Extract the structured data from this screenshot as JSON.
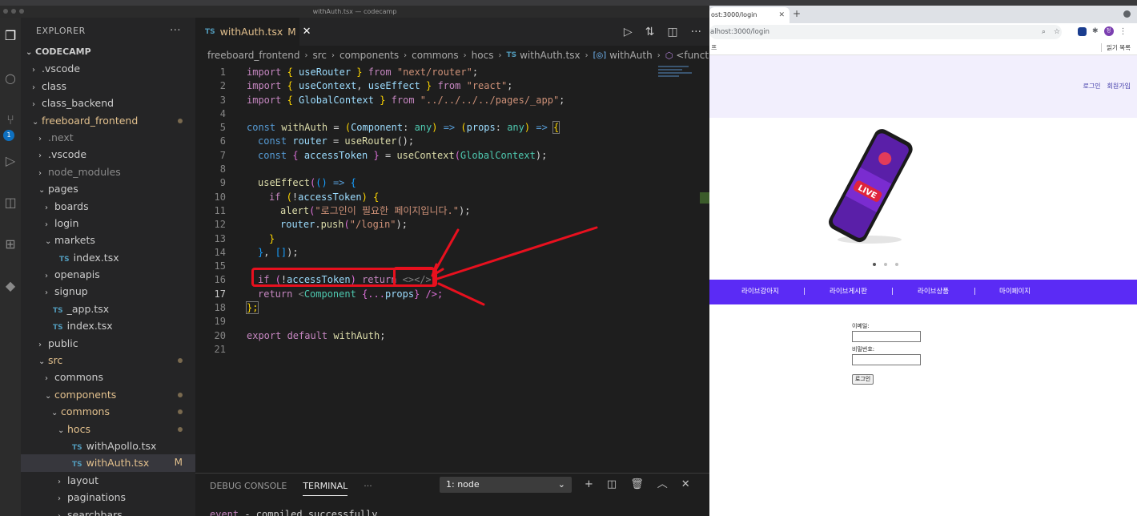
{
  "vscode": {
    "title": "withAuth.tsx — codecamp",
    "activity_badge": "1",
    "explorer": {
      "header": "EXPLORER",
      "more": "···",
      "project": "CODECAMP",
      "tree": [
        {
          "label": ".vscode",
          "depth": 1,
          "chev": "›",
          "kind": "folder"
        },
        {
          "label": "class",
          "depth": 1,
          "chev": "›",
          "kind": "folder"
        },
        {
          "label": "class_backend",
          "depth": 1,
          "chev": "›",
          "kind": "folder"
        },
        {
          "label": "freeboard_frontend",
          "depth": 1,
          "chev": "⌄",
          "kind": "folder",
          "modified": true
        },
        {
          "label": ".next",
          "depth": 2,
          "chev": "›",
          "kind": "folder",
          "dim": true
        },
        {
          "label": ".vscode",
          "depth": 2,
          "chev": "›",
          "kind": "folder"
        },
        {
          "label": "node_modules",
          "depth": 2,
          "chev": "›",
          "kind": "folder",
          "dim": true
        },
        {
          "label": "pages",
          "depth": 2,
          "chev": "⌄",
          "kind": "folder"
        },
        {
          "label": "boards",
          "depth": 3,
          "chev": "›",
          "kind": "folder"
        },
        {
          "label": "login",
          "depth": 3,
          "chev": "›",
          "kind": "folder"
        },
        {
          "label": "markets",
          "depth": 3,
          "chev": "⌄",
          "kind": "folder"
        },
        {
          "label": "index.tsx",
          "depth": 4,
          "kind": "file"
        },
        {
          "label": "openapis",
          "depth": 3,
          "chev": "›",
          "kind": "folder"
        },
        {
          "label": "signup",
          "depth": 3,
          "chev": "›",
          "kind": "folder"
        },
        {
          "label": "_app.tsx",
          "depth": 3,
          "kind": "file"
        },
        {
          "label": "index.tsx",
          "depth": 3,
          "kind": "file"
        },
        {
          "label": "public",
          "depth": 2,
          "chev": "›",
          "kind": "folder"
        },
        {
          "label": "src",
          "depth": 2,
          "chev": "⌄",
          "kind": "folder",
          "modified": true
        },
        {
          "label": "commons",
          "depth": 3,
          "chev": "›",
          "kind": "folder"
        },
        {
          "label": "components",
          "depth": 3,
          "chev": "⌄",
          "kind": "folder",
          "modified": true
        },
        {
          "label": "commons",
          "depth": 4,
          "chev": "⌄",
          "kind": "folder",
          "modified": true
        },
        {
          "label": "hocs",
          "depth": 5,
          "chev": "⌄",
          "kind": "folder",
          "modified": true
        },
        {
          "label": "withApollo.tsx",
          "depth": 6,
          "kind": "file"
        },
        {
          "label": "withAuth.tsx",
          "depth": 6,
          "kind": "file",
          "selected": true,
          "badge": "M"
        },
        {
          "label": "layout",
          "depth": 5,
          "chev": "›",
          "kind": "folder"
        },
        {
          "label": "paginations",
          "depth": 5,
          "chev": "›",
          "kind": "folder"
        },
        {
          "label": "searchbars",
          "depth": 5,
          "chev": "›",
          "kind": "folder"
        }
      ],
      "file_type": "TS"
    },
    "tab": {
      "label": "withAuth.tsx",
      "badge": "M",
      "close": "✕",
      "type": "TS"
    },
    "breadcrumb": [
      "freeboard_frontend",
      "src",
      "components",
      "commons",
      "hocs",
      "withAuth.tsx",
      "withAuth",
      "<function>"
    ],
    "code_lines": [
      "1",
      "2",
      "3",
      "4",
      "5",
      "6",
      "7",
      "8",
      "9",
      "10",
      "11",
      "12",
      "13",
      "14",
      "15",
      "16",
      "17",
      "18",
      "19",
      "20",
      "21"
    ],
    "code": {
      "l1": {
        "a": "import",
        "b": "{ ",
        "c": "useRouter",
        "d": " }",
        "e": " from ",
        "f": "\"next/router\"",
        "g": ";"
      },
      "l2": {
        "a": "import",
        "b": "{ ",
        "c": "useContext",
        "c2": ", ",
        "c3": "useEffect",
        "d": " }",
        "e": " from ",
        "f": "\"react\"",
        "g": ";"
      },
      "l3": {
        "a": "import",
        "b": "{ ",
        "c": "GlobalContext",
        "d": " }",
        "e": " from ",
        "f": "\"../../../../pages/_app\"",
        "g": ";"
      },
      "l5": {
        "a": "const",
        "b": "withAuth",
        "c": " = ",
        "d": "(",
        "e": "Component",
        "f": ": ",
        "g": "any",
        "h": ")",
        "i": " => ",
        "j": "(",
        "k": "props",
        "l": ": ",
        "m": "any",
        "n": ")",
        "o": " => ",
        "p": "{"
      },
      "l6": {
        "a": "const",
        "b": "router",
        "c": " = ",
        "d": "useRouter",
        "e": "();"
      },
      "l7": {
        "a": "const",
        "b": "{ ",
        "c": "accessToken",
        "d": " }",
        "e": " = ",
        "f": "useContext",
        "g": "(",
        "h": "GlobalContext",
        "i": ");"
      },
      "l9": {
        "a": "useEffect",
        "b": "(",
        "c": "()",
        "d": " => ",
        "e": "{"
      },
      "l10": {
        "a": "if",
        "b": " (",
        "c": "!",
        "d": "accessToken",
        "e": ") ",
        "f": "{"
      },
      "l11": {
        "a": "alert",
        "b": "(",
        "c": "\"로그인이 필요한 페이지입니다.\"",
        "d": ");"
      },
      "l12": {
        "a": "router",
        "b": ".",
        "c": "push",
        "d": "(",
        "e": "\"/login\"",
        "f": ");"
      },
      "l13": {
        "a": "}"
      },
      "l14": {
        "a": "}",
        "b": ", ",
        "c": "[]",
        "d": ");"
      },
      "l16": {
        "a": "if",
        "b": " (",
        "c": "!",
        "d": "accessToken",
        "e": ") ",
        "f": "return",
        "g": " <></>"
      },
      "l17": {
        "a": "return",
        "b": " <",
        "c": "Component",
        "d": " {...",
        "e": "props",
        "f": "} />;"
      },
      "l18": {
        "a": "};"
      },
      "l20": {
        "a": "export",
        "b": " default ",
        "c": "withAuth",
        "d": ";"
      }
    },
    "panel": {
      "tabs": [
        "DEBUG CONSOLE",
        "TERMINAL"
      ],
      "more": "···",
      "terminal_select": "1: node",
      "terminal_line_event": "event",
      "terminal_line_text": " - compiled successfully"
    }
  },
  "browser": {
    "tab_title": "ost:3000/login",
    "tab_close": "✕",
    "new_tab": "+",
    "url": "alhost:3000/login",
    "apps_label": "프",
    "reading_list": "읽기 목록",
    "profile_initial": "정",
    "header_links": [
      "로그인",
      "회원가입"
    ],
    "nav": [
      "라이브강아지",
      "|",
      "라이브게시판",
      "|",
      "라이브상품",
      "|",
      "마이페이지"
    ],
    "banner_text": "LIVE",
    "form": {
      "email_label": "이메일:",
      "password_label": "비밀번호:",
      "submit": "로그인"
    }
  },
  "colors": {
    "vscode_bg": "#1e1e1e",
    "sidebar_bg": "#252526",
    "annotation_red": "#e8101e",
    "nav_purple": "#5b2bf5"
  }
}
